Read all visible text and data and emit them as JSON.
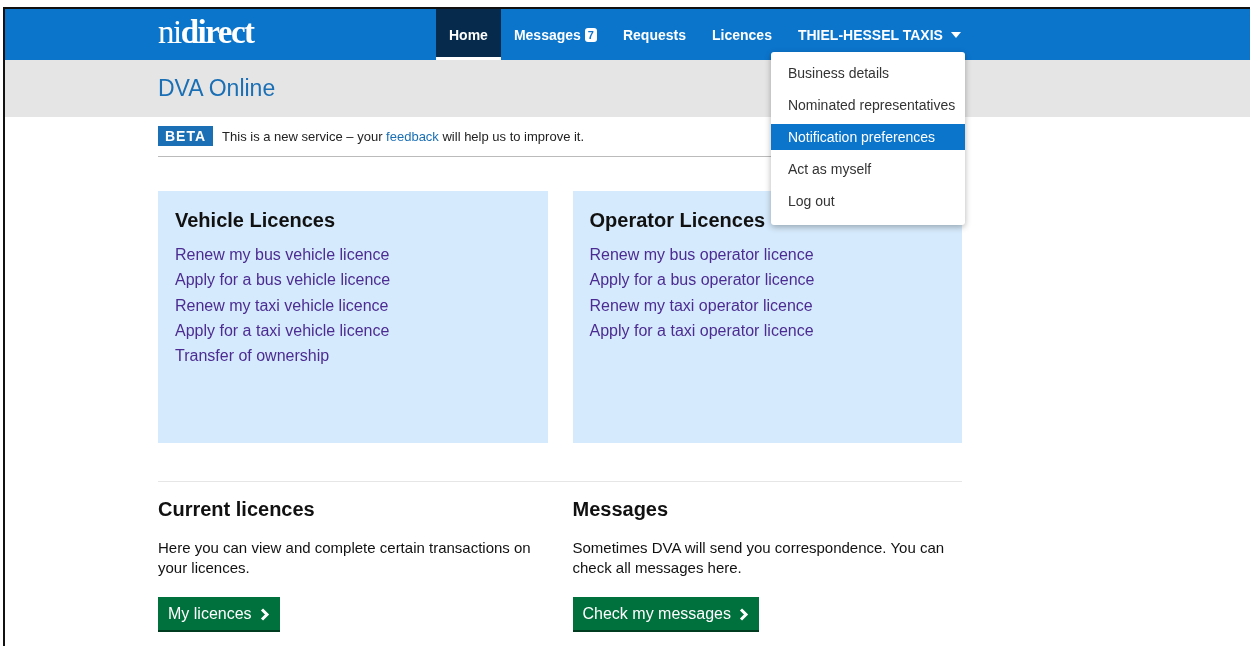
{
  "header": {
    "logo": "ni**direct**",
    "nav": [
      {
        "label": "Home",
        "selected": true
      },
      {
        "label": "Messages",
        "badge": "7",
        "selected": false
      },
      {
        "label": "Requests",
        "selected": false
      },
      {
        "label": "Licences",
        "selected": false
      }
    ],
    "account_menu": {
      "label": "THIEL-HESSEL TAXIS",
      "expanded": true,
      "items": [
        {
          "label": "Business details",
          "selected": false
        },
        {
          "label": "Nominated representatives",
          "selected": false
        },
        {
          "label": "Notification preferences",
          "selected": true
        },
        {
          "label": "Act as myself",
          "selected": false
        },
        {
          "label": "Log out",
          "selected": false
        }
      ]
    }
  },
  "page_title": "DVA Online",
  "beta_banner": {
    "tag": "BETA",
    "text_before": "This is a new service – your",
    "link": "feedback",
    "text_after": "will help us to improve it."
  },
  "cards": [
    {
      "title": "Vehicle Licences",
      "links": [
        "Renew my bus vehicle licence",
        "Apply for a bus vehicle licence",
        "Renew my taxi vehicle licence",
        "Apply for a taxi vehicle licence",
        "Transfer of ownership"
      ]
    },
    {
      "title": "Operator Licences",
      "links": [
        "Renew my bus operator licence",
        "Apply for a bus operator licence",
        "Renew my taxi operator licence",
        "Apply for a taxi operator licence"
      ]
    }
  ],
  "sections": [
    {
      "title": "Current licences",
      "text": "Here you can view and complete certain transactions on your licences.",
      "button": "My licences"
    },
    {
      "title": "Messages",
      "text": "Sometimes DVA will send you correspondence. You can check all messages here.",
      "button": "Check my messages"
    }
  ]
}
